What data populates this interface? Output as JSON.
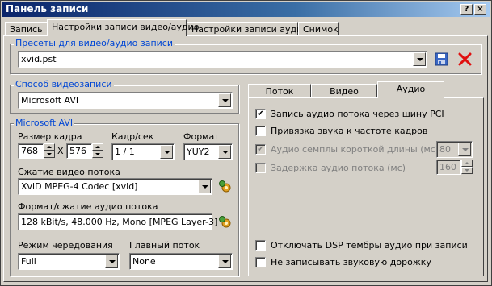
{
  "window": {
    "title": "Панель записи"
  },
  "tabs": [
    "Запись",
    "Настройки записи видео/аудио",
    "Настройки записи аудио",
    "Снимок"
  ],
  "presets": {
    "label": "Пресеты для видео/аудио записи",
    "value": "xvid.pst",
    "save_icon": "floppy-disk-icon",
    "delete_icon": "red-x-icon"
  },
  "video_method": {
    "label": "Способ видеозаписи",
    "value": "Microsoft AVI"
  },
  "avi": {
    "label": "Microsoft AVI",
    "frame_size_label": "Размер кадра",
    "width": "768",
    "x_sep": "X",
    "height": "576",
    "fps_label": "Кадр/сек",
    "fps": "1 / 1",
    "format_label": "Формат",
    "format": "YUY2",
    "video_comp_label": "Сжатие видео потока",
    "video_codec": "XviD MPEG-4 Codec [xvid]",
    "audio_comp_label": "Формат/сжатие аудио потока",
    "audio_codec": "128 kBit/s, 48.000 Hz, Mono [MPEG Layer-3]",
    "interleave_label": "Режим чередования",
    "interleave": "Full",
    "master_label": "Главный поток",
    "master": "None",
    "settings_icon": "gear-settings-icon"
  },
  "subtabs": [
    "Поток",
    "Видео",
    "Аудио"
  ],
  "audio": {
    "opt_pci": "Запись аудио потока через шину PCI",
    "opt_pci_checked": "✔",
    "opt_sync": "Привязка звука к частоте кадров",
    "opt_short": "Аудио семплы короткой длины (мс)",
    "opt_short_checked": "✔",
    "short_value": "80",
    "opt_delay": "Задержка аудио потока (мс)",
    "delay_value": "160",
    "opt_dsp": "Отключать DSP тембры аудио при записи",
    "opt_notrack": "Не записывать звуковую дорожку"
  }
}
